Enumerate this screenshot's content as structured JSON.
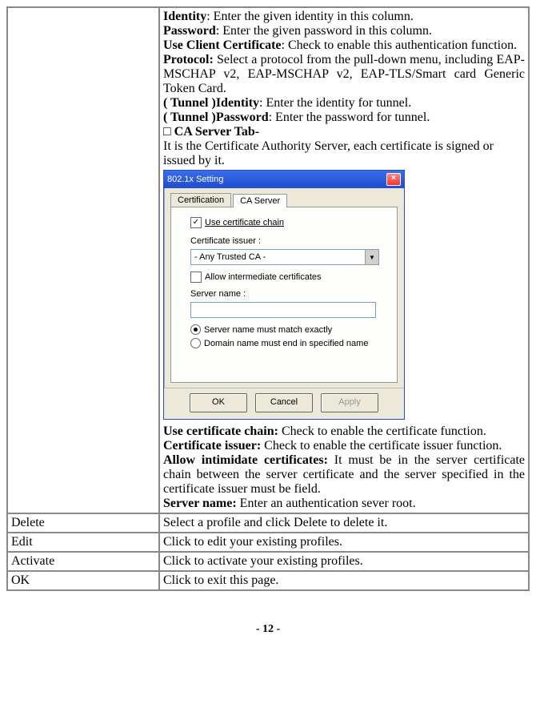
{
  "rows": [
    {
      "left": "",
      "content": {
        "defs": [
          {
            "term": "Identity",
            "text": ": Enter the given identity in this column."
          },
          {
            "term": "Password",
            "text": ": Enter the given password in this column."
          },
          {
            "term": "Use Client Certificate",
            "text": ": Check to enable this authentication function."
          },
          {
            "term": "Protocol:",
            "text": " Select a protocol from the pull-down menu, including EAP-MSCHAP v2, EAP-MSCHAP v2, EAP-TLS/Smart card Generic Token Card.",
            "justify": true
          },
          {
            "term": "( Tunnel )Identity",
            "text": ": Enter the identity for tunnel."
          },
          {
            "term": "( Tunnel )Password",
            "text": ": Enter the password for tunnel."
          }
        ],
        "bullet": {
          "symbol": "□",
          "label": "CA Server Tab-"
        },
        "bullet_desc": "It is the Certificate Authority Server, each certificate is signed or issued by it.",
        "dialog": {
          "title": "802.1x Setting",
          "tabs": [
            "Certification",
            "CA Server"
          ],
          "active_tab": 1,
          "use_cert_chain": {
            "label": "Use certificate chain",
            "checked": true
          },
          "cert_issuer_label": "Certificate issuer :",
          "cert_issuer_value": "- Any Trusted CA -",
          "allow_intermediate": {
            "label": "Allow intermediate certificates",
            "checked": false
          },
          "server_name_label": "Server name :",
          "server_name_value": "",
          "radio_match": {
            "label": "Server name must match exactly",
            "selected": true
          },
          "radio_domain": {
            "label": "Domain name must end in specified name",
            "selected": false
          },
          "buttons": {
            "ok": "OK",
            "cancel": "Cancel",
            "apply": "Apply"
          }
        },
        "defs2": [
          {
            "term": "Use certificate chain:",
            "text": " Check to enable the certificate function.",
            "justify": true
          },
          {
            "term": "Certificate issuer:",
            "text": " Check to enable the certificate issuer function.",
            "justify": true
          },
          {
            "term": "Allow intimidate certificates:",
            "text": " It must be in the server certificate chain between the server certificate and the server specified in the certificate issuer must be field.",
            "justify": true
          },
          {
            "term": "Server name:",
            "text": " Enter an authentication sever root."
          }
        ]
      }
    },
    {
      "left": "Delete",
      "right": "Select a profile and click Delete to delete it."
    },
    {
      "left": "Edit",
      "right": "Click to edit your existing profiles."
    },
    {
      "left": "Activate",
      "right": "Click to activate your existing profiles."
    },
    {
      "left": "OK",
      "right": "Click to exit this page."
    }
  ],
  "page_number": "- 12 -"
}
